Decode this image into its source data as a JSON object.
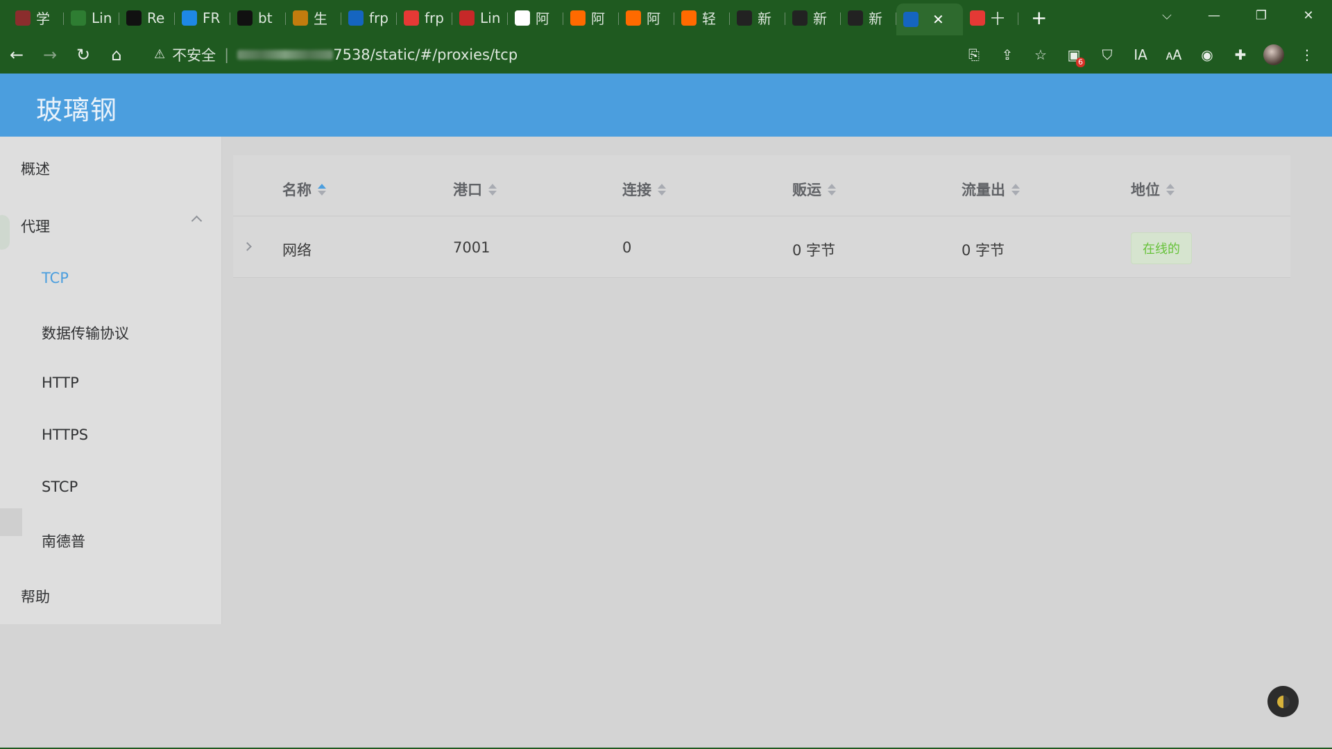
{
  "browser": {
    "tabs": [
      {
        "label": "学",
        "icon": "app-icon",
        "color": "#8b2d2d"
      },
      {
        "label": "Lin",
        "icon": "shield-icon",
        "color": "#2e7d32"
      },
      {
        "label": "Re",
        "icon": "github-icon",
        "color": "#111111"
      },
      {
        "label": "FR",
        "icon": "lee-icon",
        "color": "#1e88e5"
      },
      {
        "label": "bt",
        "icon": "github-icon",
        "color": "#111111"
      },
      {
        "label": "生",
        "icon": "app-icon",
        "color": "#c27c0e"
      },
      {
        "label": "frp",
        "icon": "feather-icon",
        "color": "#1565c0"
      },
      {
        "label": "frp",
        "icon": "csdn-icon",
        "color": "#e53935"
      },
      {
        "label": "Lin",
        "icon": "51cto-icon",
        "color": "#c62828"
      },
      {
        "label": "阿",
        "icon": "google-icon",
        "color": "#ffffff"
      },
      {
        "label": "阿",
        "icon": "aliyun-icon",
        "color": "#ff6a00"
      },
      {
        "label": "阿",
        "icon": "aliyun-icon",
        "color": "#ff6a00"
      },
      {
        "label": "轻",
        "icon": "aliyun-icon",
        "color": "#ff6a00"
      },
      {
        "label": "新",
        "icon": "infinity-icon",
        "color": "#222222"
      },
      {
        "label": "新",
        "icon": "infinity-icon",
        "color": "#222222"
      },
      {
        "label": "新",
        "icon": "infinity-icon",
        "color": "#222222"
      },
      {
        "label": "",
        "icon": "feather-icon",
        "color": "#1565c0",
        "active": true
      },
      {
        "label": "十",
        "icon": "csdn-icon",
        "color": "#e53935"
      }
    ],
    "url": {
      "security": "不安全",
      "path": "7538/static/#/proxies/tcp"
    },
    "extension_badge": "6",
    "ext_ia": "IA"
  },
  "app": {
    "title": "玻璃钢"
  },
  "sidebar": {
    "overview": "概述",
    "proxy": "代理",
    "submenu": [
      "TCP",
      "数据传输协议",
      "HTTP",
      "HTTPS",
      "STCP",
      "南德普"
    ],
    "help": "帮助"
  },
  "table": {
    "columns": [
      "名称",
      "港口",
      "连接",
      "贩运",
      "流量出",
      "地位"
    ],
    "rows": [
      {
        "name": "网络",
        "port": "7001",
        "connections": "0",
        "traffic_in": "0 字节",
        "traffic_out": "0 字节",
        "status": "在线的"
      }
    ]
  }
}
